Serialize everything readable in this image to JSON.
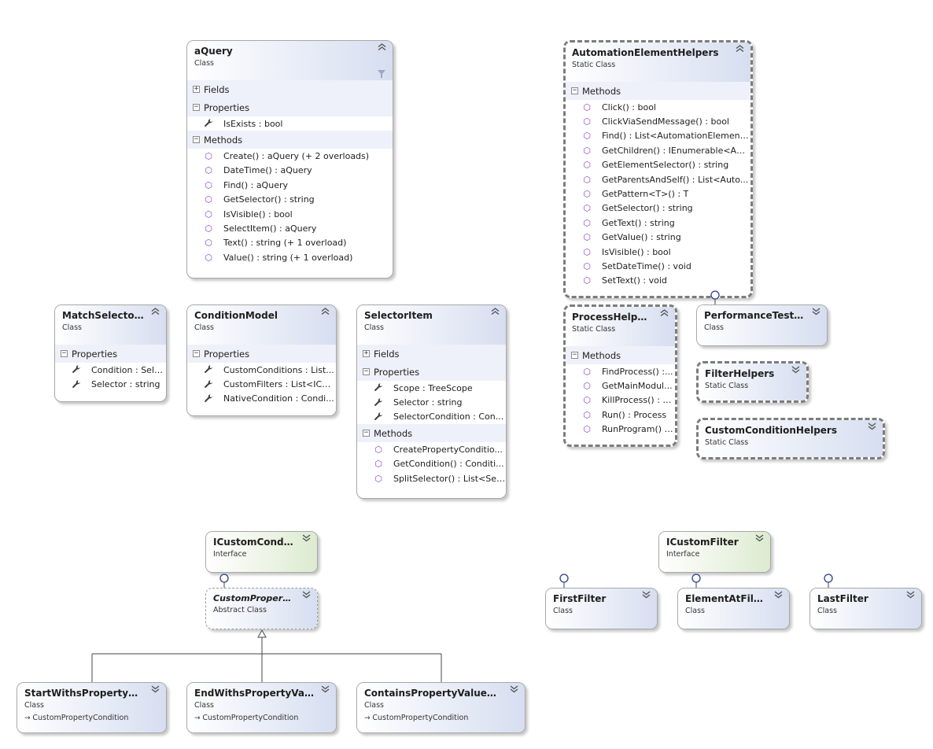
{
  "colors": {
    "class_header": "#d6def0",
    "interface_header": "#dcebd0",
    "method_icon": "#8b43c4",
    "border": "#a8a8a8",
    "static_border": "#7c7c7c"
  },
  "icons": {
    "collapse": "chevron-up-double-icon",
    "expand": "chevron-down-double-icon",
    "method": "method-cube-icon",
    "property": "wrench-icon",
    "filter": "funnel-icon",
    "lollipop": "interface-lollipop-icon",
    "inherit": "arrow-right-icon"
  },
  "boxes": [
    {
      "id": "aQuery",
      "name": "aQuery",
      "kind": "Class",
      "collapsed": false,
      "filter_icon": true,
      "sections": [
        {
          "label": "Fields",
          "expanded": false,
          "items": []
        },
        {
          "label": "Properties",
          "expanded": true,
          "items": [
            {
              "icon": "prop",
              "text": "IsExists : bool"
            }
          ]
        },
        {
          "label": "Methods",
          "expanded": true,
          "items": [
            {
              "icon": "method",
              "text": "Create() : aQuery (+ 2 overloads)"
            },
            {
              "icon": "method",
              "text": "DateTime() : aQuery"
            },
            {
              "icon": "method",
              "text": "Find() : aQuery"
            },
            {
              "icon": "method",
              "text": "GetSelector() : string"
            },
            {
              "icon": "method",
              "text": "IsVisible() : bool"
            },
            {
              "icon": "method",
              "text": "SelectItem() : aQuery"
            },
            {
              "icon": "method",
              "text": "Text() : string (+ 1 overload)"
            },
            {
              "icon": "method",
              "text": "Value() : string (+ 1 overload)"
            }
          ]
        }
      ]
    },
    {
      "id": "AutomationElementHelpers",
      "name": "AutomationElementHelpers",
      "kind": "Static Class",
      "collapsed": false,
      "sections": [
        {
          "label": "Methods",
          "expanded": true,
          "items": [
            {
              "icon": "method",
              "text": "Click() : bool"
            },
            {
              "icon": "method",
              "text": "ClickViaSendMessage() : bool"
            },
            {
              "icon": "method",
              "text": "Find() : List<AutomationElement..."
            },
            {
              "icon": "method",
              "text": "GetChildren() : IEnumerable<Aut..."
            },
            {
              "icon": "method",
              "text": "GetElementSelector() : string"
            },
            {
              "icon": "method",
              "text": "GetParentsAndSelf() : List<Auto..."
            },
            {
              "icon": "method",
              "text": "GetPattern<T>() : T"
            },
            {
              "icon": "method",
              "text": "GetSelector() : string"
            },
            {
              "icon": "method",
              "text": "GetText() : string"
            },
            {
              "icon": "method",
              "text": "GetValue() : string"
            },
            {
              "icon": "method",
              "text": "IsVisible() : bool"
            },
            {
              "icon": "method",
              "text": "SetDateTime() : void"
            },
            {
              "icon": "method",
              "text": "SetText() : void"
            }
          ]
        }
      ]
    },
    {
      "id": "MatchSelectorC",
      "name": "MatchSelectorC...",
      "kind": "Class",
      "collapsed": false,
      "sections": [
        {
          "label": "Properties",
          "expanded": true,
          "items": [
            {
              "icon": "prop",
              "text": "Condition : Sele..."
            },
            {
              "icon": "prop",
              "text": "Selector : string"
            }
          ]
        }
      ]
    },
    {
      "id": "ConditionModel",
      "name": "ConditionModel",
      "kind": "Class",
      "collapsed": false,
      "sections": [
        {
          "label": "Properties",
          "expanded": true,
          "items": [
            {
              "icon": "prop",
              "text": "CustomConditions : List..."
            },
            {
              "icon": "prop",
              "text": "CustomFilters : List<ICus..."
            },
            {
              "icon": "prop",
              "text": "NativeCondition : Condi..."
            }
          ]
        }
      ]
    },
    {
      "id": "SelectorItem",
      "name": "SelectorItem",
      "kind": "Class",
      "collapsed": false,
      "sections": [
        {
          "label": "Fields",
          "expanded": false,
          "items": []
        },
        {
          "label": "Properties",
          "expanded": true,
          "items": [
            {
              "icon": "prop",
              "text": "Scope : TreeScope"
            },
            {
              "icon": "prop",
              "text": "Selector : string"
            },
            {
              "icon": "prop",
              "text": "SelectorCondition : Con..."
            }
          ]
        },
        {
          "label": "Methods",
          "expanded": true,
          "items": [
            {
              "icon": "method",
              "text": "CreatePropertyConditio..."
            },
            {
              "icon": "method",
              "text": "GetCondition() : Conditi..."
            },
            {
              "icon": "method",
              "text": "SplitSelector() : List<Sel..."
            }
          ]
        }
      ]
    },
    {
      "id": "ProcessHelpers",
      "name": "ProcessHelpers",
      "kind": "Static Class",
      "collapsed": false,
      "sections": [
        {
          "label": "Methods",
          "expanded": true,
          "items": [
            {
              "icon": "method",
              "text": "FindProcess() :..."
            },
            {
              "icon": "method",
              "text": "GetMainModul..."
            },
            {
              "icon": "method",
              "text": "KillProcess() : v..."
            },
            {
              "icon": "method",
              "text": "Run() : Process"
            },
            {
              "icon": "method",
              "text": "RunProgram() :..."
            }
          ]
        }
      ]
    },
    {
      "id": "PerformanceTester",
      "name": "PerformanceTester",
      "kind": "Class",
      "collapsed": true,
      "sections": []
    },
    {
      "id": "FilterHelpers",
      "name": "FilterHelpers",
      "kind": "Static Class",
      "collapsed": true,
      "sections": []
    },
    {
      "id": "CustomConditionHelpers",
      "name": "CustomConditionHelpers",
      "kind": "Static Class",
      "collapsed": true,
      "sections": []
    },
    {
      "id": "ICustomCondition",
      "name": "ICustomCondition",
      "kind": "Interface",
      "collapsed": true,
      "sections": []
    },
    {
      "id": "CustomPropertyCo",
      "name": "CustomPropertyCo...",
      "kind": "Abstract Class",
      "collapsed": true,
      "sections": []
    },
    {
      "id": "StartWithsPropertyValu",
      "name": "StartWithsPropertyValu...",
      "kind": "Class",
      "base": "CustomPropertyCondition",
      "collapsed": true,
      "sections": []
    },
    {
      "id": "EndWithsPropertyValue",
      "name": "EndWithsPropertyValue...",
      "kind": "Class",
      "base": "CustomPropertyCondition",
      "collapsed": true,
      "sections": []
    },
    {
      "id": "ContainsPropertyValueCondi",
      "name": "ContainsPropertyValueCondi...",
      "kind": "Class",
      "base": "CustomPropertyCondition",
      "collapsed": true,
      "sections": []
    },
    {
      "id": "ICustomFilter",
      "name": "ICustomFilter",
      "kind": "Interface",
      "collapsed": true,
      "sections": []
    },
    {
      "id": "FirstFilter",
      "name": "FirstFilter",
      "kind": "Class",
      "collapsed": true,
      "sections": []
    },
    {
      "id": "ElementAtFilter",
      "name": "ElementAtFilter",
      "kind": "Class",
      "collapsed": true,
      "sections": []
    },
    {
      "id": "LastFilter",
      "name": "LastFilter",
      "kind": "Class",
      "collapsed": true,
      "sections": []
    }
  ]
}
